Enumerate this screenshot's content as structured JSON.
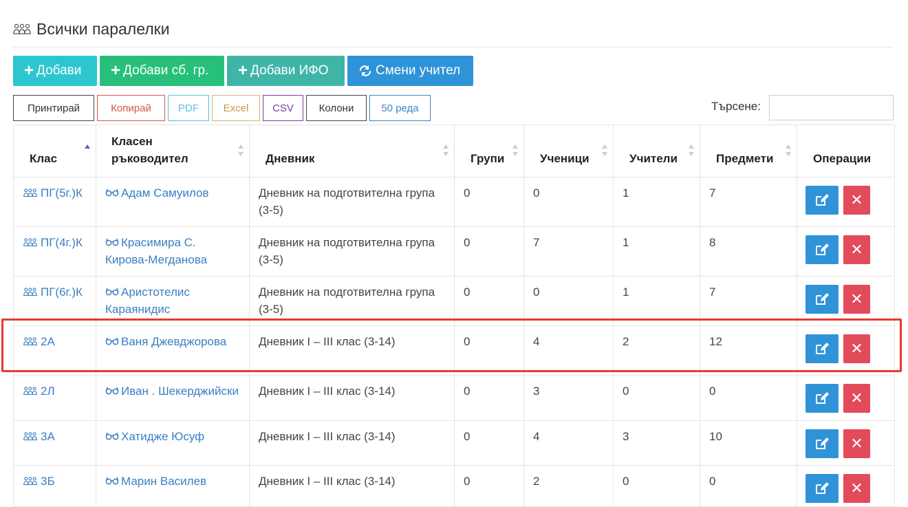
{
  "page": {
    "title": "Всички паралелки",
    "title_icon": "group-icon"
  },
  "toolbar": {
    "add": "Добави",
    "add_group": "Добави сб. гр.",
    "add_ifo": "Добави ИФО",
    "change_teacher": "Смени учител",
    "plus_icon": "plus-icon",
    "swap_icon": "swap-icon"
  },
  "export": {
    "print": "Принтирай",
    "copy": "Копирай",
    "pdf": "PDF",
    "excel": "Excel",
    "csv": "CSV",
    "columns": "Колони",
    "rows": "50 реда"
  },
  "search": {
    "label": "Търсене:",
    "value": ""
  },
  "table": {
    "headers": {
      "class": "Клас",
      "teacher_line1": "Класен",
      "teacher_line2": "ръководител",
      "diary": "Дневник",
      "groups": "Групи",
      "students": "Ученици",
      "teachers": "Учители",
      "subjects": "Предмети",
      "operations": "Операции"
    },
    "rows": [
      {
        "class": "ПГ(5г.)К",
        "teacher": "Адам Самуилов",
        "diary": "Дневник на подготвителна група (3-5)",
        "groups": "0",
        "students": "0",
        "teachers": "1",
        "subjects": "7"
      },
      {
        "class": "ПГ(4г.)К",
        "teacher": "Красимира С. Кирова-Мегданова",
        "diary": "Дневник на подготвителна група (3-5)",
        "groups": "0",
        "students": "7",
        "teachers": "1",
        "subjects": "8"
      },
      {
        "class": "ПГ(6г.)К",
        "teacher": "Аристотелис Караянидис",
        "diary": "Дневник на подготвителна група (3-5)",
        "groups": "0",
        "students": "0",
        "teachers": "1",
        "subjects": "7"
      },
      {
        "class": "2А",
        "teacher": "Ваня Джевджорова",
        "diary": "Дневник I – III клас (3-14)",
        "groups": "0",
        "students": "4",
        "teachers": "2",
        "subjects": "12"
      },
      {
        "class": "2Л",
        "teacher": "Иван . Шекерджийски",
        "diary": "Дневник I – III клас (3-14)",
        "groups": "0",
        "students": "3",
        "teachers": "0",
        "subjects": "0"
      },
      {
        "class": "3А",
        "teacher": "Хатидже Юсуф",
        "diary": "Дневник I – III клас (3-14)",
        "groups": "0",
        "students": "4",
        "teachers": "3",
        "subjects": "10"
      },
      {
        "class": "3Б",
        "teacher": "Марин Василев",
        "diary": "Дневник I – III клас (3-14)",
        "groups": "0",
        "students": "2",
        "teachers": "0",
        "subjects": "0"
      }
    ],
    "class_icon": "group-icon",
    "teacher_icon": "glasses-icon",
    "edit_icon": "edit-icon",
    "delete_icon": "delete-icon",
    "highlighted_row_index": 3
  },
  "colors": {
    "add": "#2ec6ce",
    "add_group": "#27c07a",
    "add_ifo": "#3fb5a8",
    "change_teacher": "#2f93d8",
    "edit": "#2f93d8",
    "delete": "#e24b5a",
    "link": "#3a7fc2",
    "highlight": "#e53a2f"
  }
}
